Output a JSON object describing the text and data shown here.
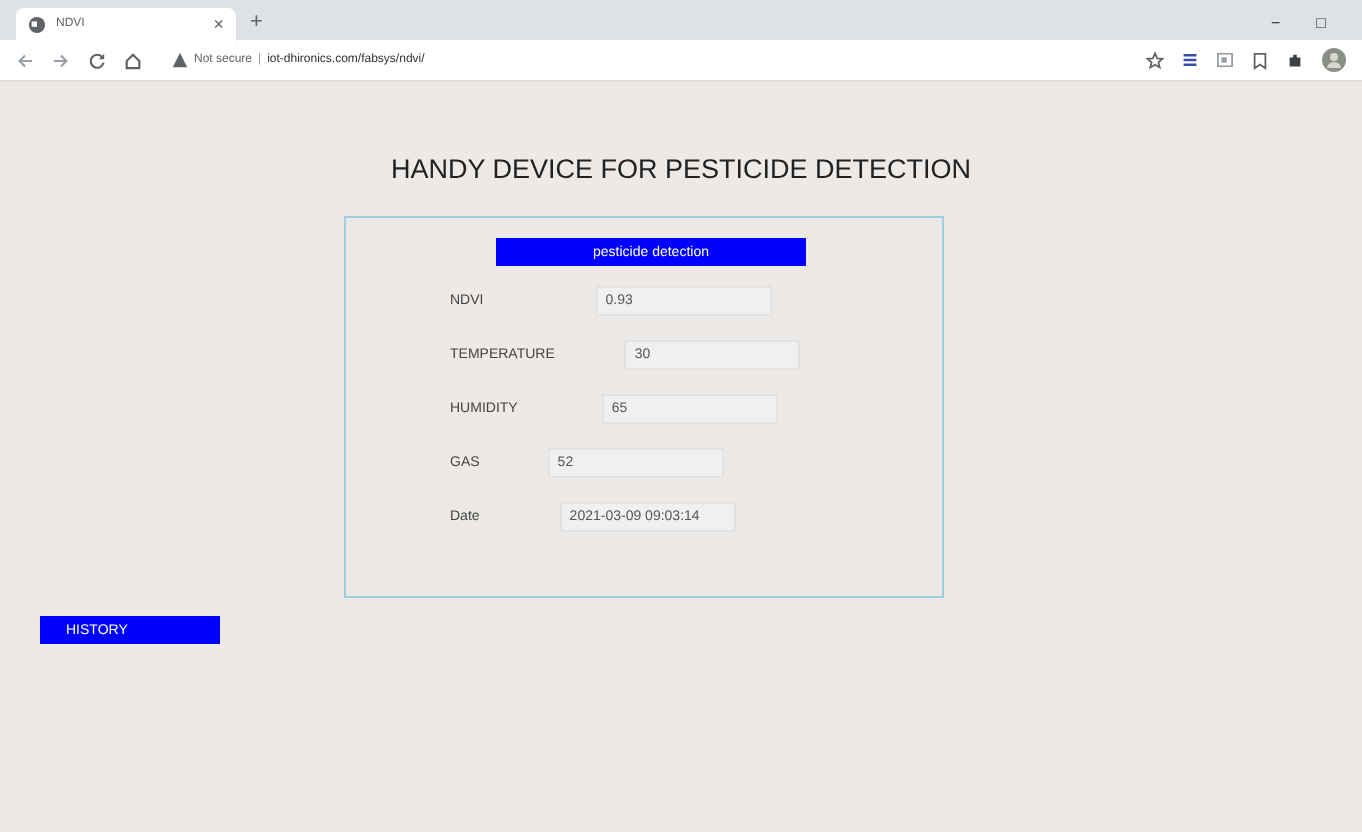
{
  "browser": {
    "tab": {
      "title": "NDVI",
      "close": "×"
    },
    "new_tab": "+",
    "window_controls": [
      "−",
      "□"
    ],
    "security": "Not secure",
    "separator": "|",
    "url": "iot-dhironics.com/fabsys/ndvi/"
  },
  "page": {
    "title": "HANDY DEVICE FOR PESTICIDE DETECTION",
    "panel": {
      "header": "pesticide detection",
      "fields": [
        {
          "label": "NDVI",
          "value": "0.93"
        },
        {
          "label": "TEMPERATURE",
          "value": "30"
        },
        {
          "label": "HUMIDITY",
          "value": "65"
        },
        {
          "label": "GAS",
          "value": "52"
        },
        {
          "label": "Date",
          "value": "2021-03-09 09:03:14"
        }
      ]
    },
    "history_button": "HISTORY"
  }
}
